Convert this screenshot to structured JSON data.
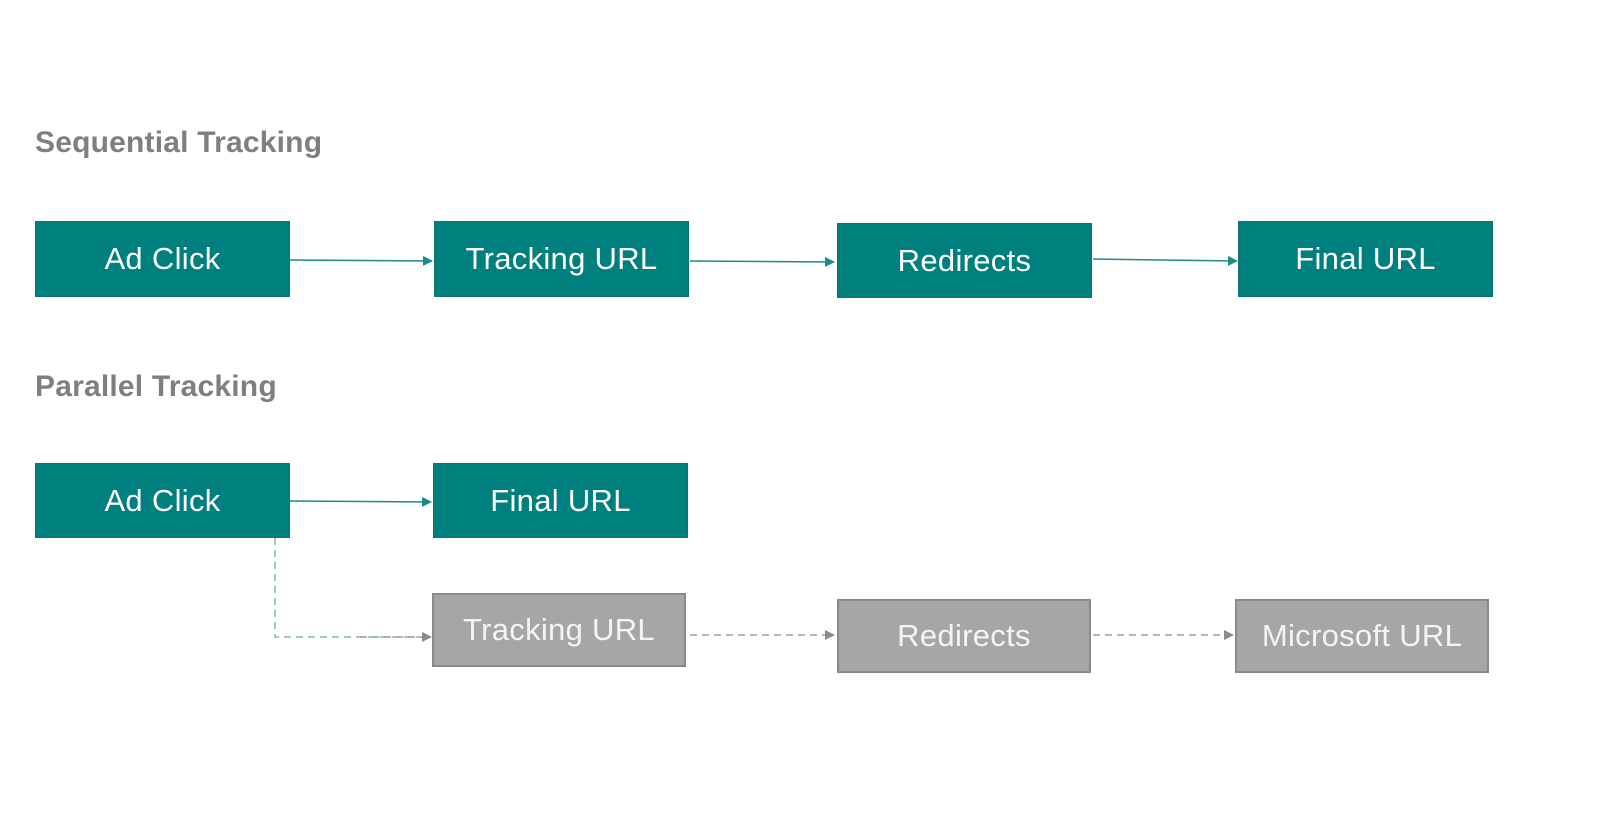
{
  "colors": {
    "primary": "#007f7f",
    "secondary": "#a6a6a6",
    "title": "#7f7f7f",
    "primary_line": "#1a8a8a",
    "secondary_line": "#9e9e9e"
  },
  "sequential": {
    "title": "Sequential Tracking",
    "nodes": [
      {
        "label": "Ad Click",
        "style": "primary"
      },
      {
        "label": "Tracking URL",
        "style": "primary"
      },
      {
        "label": "Redirects",
        "style": "primary"
      },
      {
        "label": "Final URL",
        "style": "primary"
      }
    ],
    "edges": [
      {
        "from": "Ad Click",
        "to": "Tracking URL",
        "line": "solid"
      },
      {
        "from": "Tracking URL",
        "to": "Redirects",
        "line": "solid"
      },
      {
        "from": "Redirects",
        "to": "Final URL",
        "line": "solid"
      }
    ]
  },
  "parallel": {
    "title": "Parallel Tracking",
    "nodes": [
      {
        "label": "Ad Click",
        "style": "primary"
      },
      {
        "label": "Final URL",
        "style": "primary"
      },
      {
        "label": "Tracking URL",
        "style": "secondary"
      },
      {
        "label": "Redirects",
        "style": "secondary"
      },
      {
        "label": "Microsoft URL",
        "style": "secondary"
      }
    ],
    "edges": [
      {
        "from": "Ad Click",
        "to": "Final URL",
        "line": "solid"
      },
      {
        "from": "Ad Click",
        "to": "Tracking URL",
        "line": "dashed"
      },
      {
        "from": "Tracking URL",
        "to": "Redirects",
        "line": "dashed"
      },
      {
        "from": "Redirects",
        "to": "Microsoft URL",
        "line": "dashed"
      }
    ]
  }
}
